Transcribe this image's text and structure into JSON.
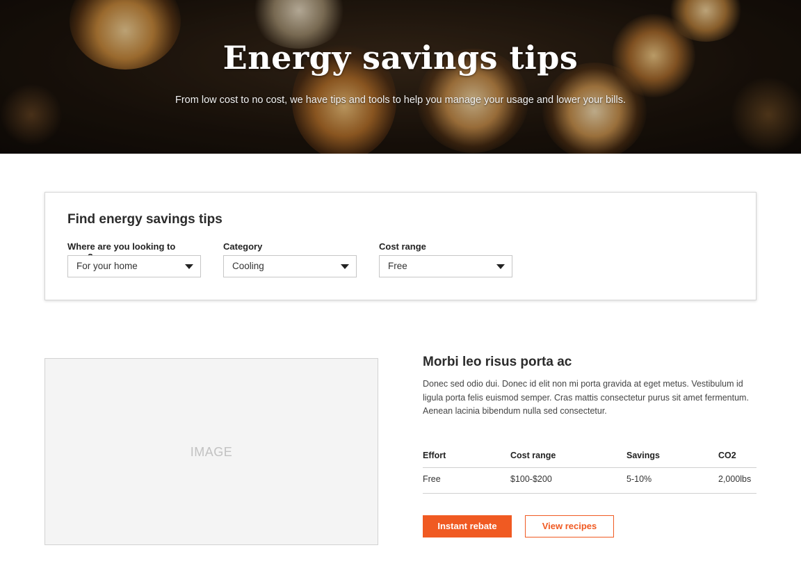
{
  "hero": {
    "title": "Energy savings tips",
    "subtitle": "From low cost to no cost, we have tips and tools to help you manage your usage and lower your bills."
  },
  "filter": {
    "title": "Find energy savings tips",
    "fields": [
      {
        "label": "Where are you looking to save?",
        "value": "For your home"
      },
      {
        "label": "Category",
        "value": "Cooling"
      },
      {
        "label": "Cost range",
        "value": "Free"
      }
    ]
  },
  "tip": {
    "image_placeholder": "IMAGE",
    "title": "Morbi leo risus porta ac",
    "body": "Donec sed odio dui. Donec id elit non mi porta gravida at eget metus. Vestibulum id ligula porta felis euismod semper. Cras mattis consectetur purus sit amet fermentum. Aenean lacinia bibendum nulla sed consectetur.",
    "table": {
      "headers": [
        "Effort",
        "Cost range",
        "Savings",
        "CO2"
      ],
      "values": [
        "Free",
        "$100-$200",
        "5-10%",
        "2,000lbs"
      ]
    },
    "buttons": {
      "primary": "Instant rebate",
      "secondary": "View recipes"
    }
  },
  "colors": {
    "accent": "#f05a22"
  }
}
